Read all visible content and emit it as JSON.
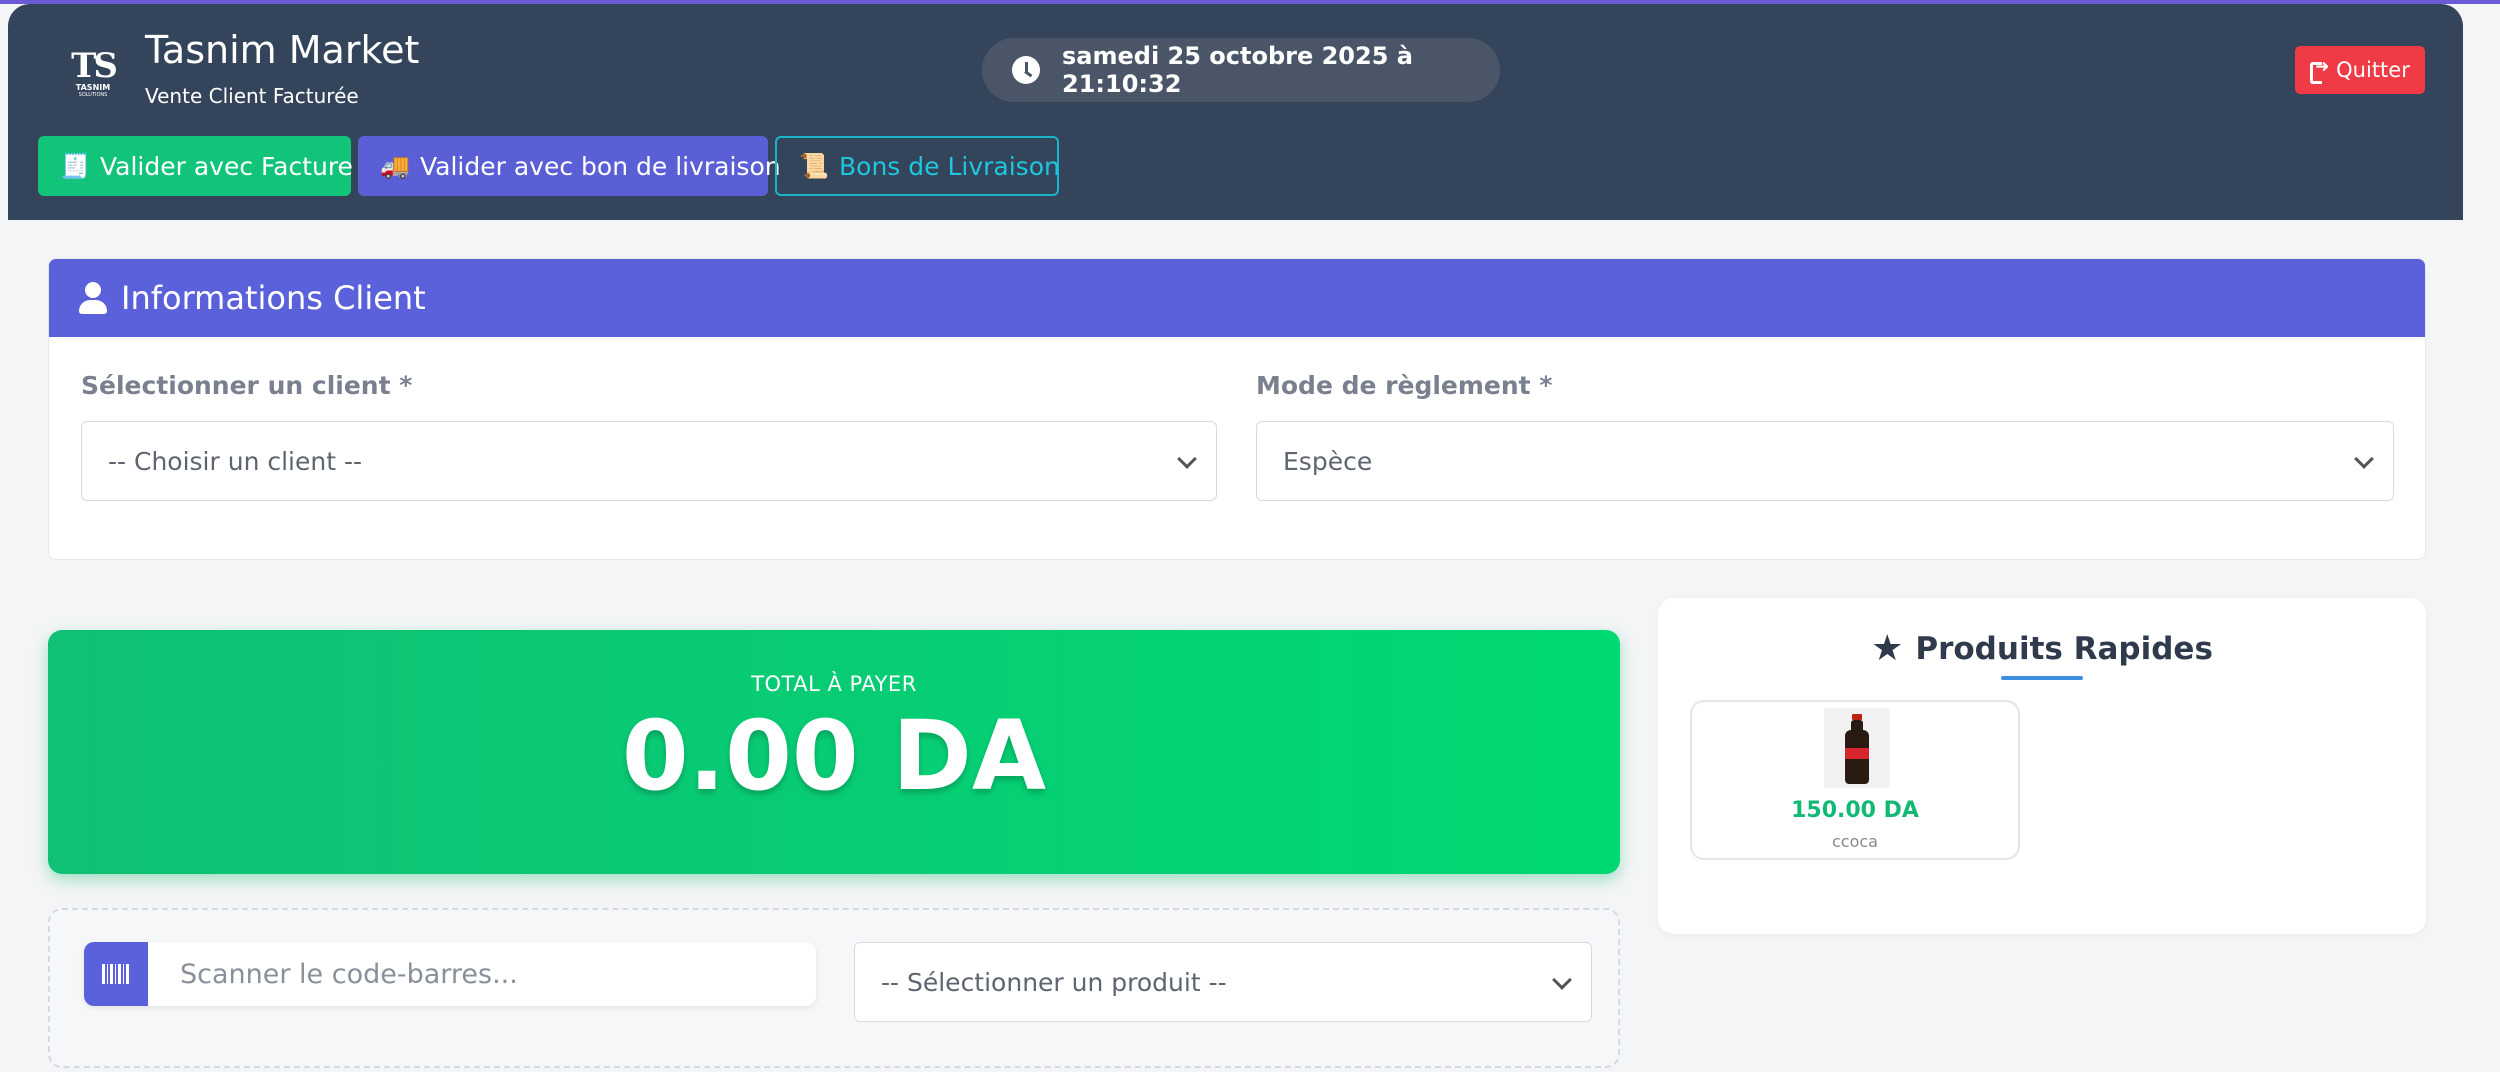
{
  "header": {
    "logo_text": "TS",
    "logo_sub": "TASNIM",
    "logo_sub2": "SOLUTIONS",
    "title": "Tasnim Market",
    "subtitle": "Vente Client Facturée",
    "datetime": "samedi 25 octobre 2025 à 21:10:32",
    "quit_label": "Quitter"
  },
  "actions": {
    "facture": {
      "emoji": "🧾",
      "label": "Valider avec Facture"
    },
    "bon_livraison": {
      "emoji": "🚚",
      "label": "Valider avec bon de livraison"
    },
    "bons_list": {
      "emoji": "📜",
      "label": "Bons de Livraison"
    }
  },
  "client_card": {
    "title": "Informations Client",
    "client_label": "Sélectionner un client *",
    "client_value": "-- Choisir un client --",
    "payment_label": "Mode de règlement *",
    "payment_value": "Espèce"
  },
  "total": {
    "label": "TOTAL À PAYER",
    "value": "0.00 DA"
  },
  "scan": {
    "placeholder": "Scanner le code-barres...",
    "product_select": "-- Sélectionner un produit --"
  },
  "quick_products": {
    "title": "Produits Rapides",
    "items": [
      {
        "price": "150.00 DA",
        "name": "ccoca"
      }
    ]
  },
  "colors": {
    "header_bg": "#34445a",
    "accent": "#5b61db",
    "success": "#12c47a",
    "danger": "#f03a45",
    "info": "#18b5cb"
  }
}
